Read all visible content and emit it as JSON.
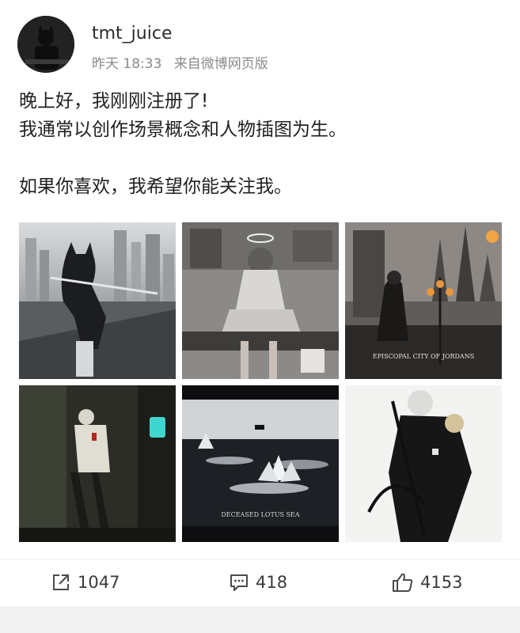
{
  "user": {
    "name": "tmt_juice",
    "time": "昨天 18:33",
    "source": "来自微博网页版"
  },
  "post": {
    "lines": [
      "晚上好，我刚刚注册了!",
      "我通常以创作场景概念和人物插图为生。",
      "如果你喜欢，我希望你能关注我。"
    ],
    "images": [
      {
        "name": "cat-eared-girl-city-illustration"
      },
      {
        "name": "halo-girl-sitting-illustration"
      },
      {
        "name": "episcopal-city-illustration",
        "caption": "EPISCOPAL CITY OF JORDANS"
      },
      {
        "name": "dark-room-figure-illustration"
      },
      {
        "name": "deceased-lotus-sea-illustration",
        "caption": "DECEASED LOTUS SEA"
      },
      {
        "name": "scythe-figure-illustration"
      }
    ]
  },
  "actions": {
    "repost_count": "1047",
    "comment_count": "418",
    "like_count": "4153"
  },
  "colors": {
    "text": "#1f1f1f",
    "meta": "#8a8a8a",
    "divider": "#ececec"
  }
}
